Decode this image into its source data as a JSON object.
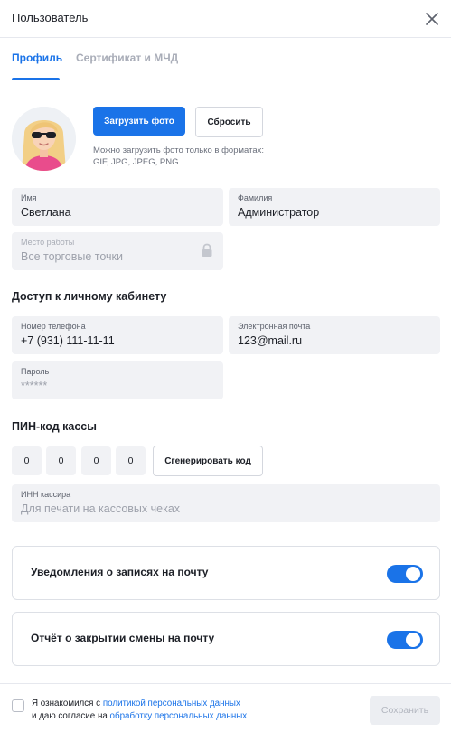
{
  "header": {
    "title": "Пользователь",
    "close_icon": "close-icon"
  },
  "tabs": [
    {
      "label": "Профиль",
      "active": true
    },
    {
      "label": "Сертификат и МЧД",
      "active": false
    }
  ],
  "photo": {
    "upload_label": "Загрузить фото",
    "reset_label": "Сбросить",
    "hint_line1": "Можно загрузить фото только в форматах:",
    "hint_line2": "GIF, JPG, JPEG, PNG"
  },
  "fields": {
    "first_name": {
      "label": "Имя",
      "value": "Светлана"
    },
    "last_name": {
      "label": "Фамилия",
      "value": "Администратор"
    },
    "workplace": {
      "label": "Место работы",
      "value": "Все торговые точки",
      "locked": true
    }
  },
  "access": {
    "title": "Доступ к личному кабинету",
    "phone": {
      "label": "Номер телефона",
      "value": "+7 (931) 111-11-11"
    },
    "email": {
      "label": "Электронная почта",
      "value": "123@mail.ru"
    },
    "password": {
      "label": "Пароль",
      "value": "******"
    }
  },
  "pin": {
    "title": "ПИН-код кассы",
    "digits": [
      "0",
      "0",
      "0",
      "0"
    ],
    "generate_label": "Сгенерировать код",
    "inn": {
      "label": "ИНН кассира",
      "placeholder": "Для печати на кассовых чеках"
    }
  },
  "notifications": [
    {
      "label": "Уведомления о записях на почту",
      "enabled": true
    },
    {
      "label": "Отчёт о закрытии смены на почту",
      "enabled": true
    }
  ],
  "footer": {
    "consent_text1": "Я ознакомился с ",
    "consent_link1": "политикой персональных данных",
    "consent_text2": "и даю согласие на ",
    "consent_link2": "обработку персональных данных",
    "save_label": "Сохранить"
  },
  "colors": {
    "accent": "#1a73e8",
    "field_bg": "#f1f2f5",
    "border": "#dde0e6"
  }
}
